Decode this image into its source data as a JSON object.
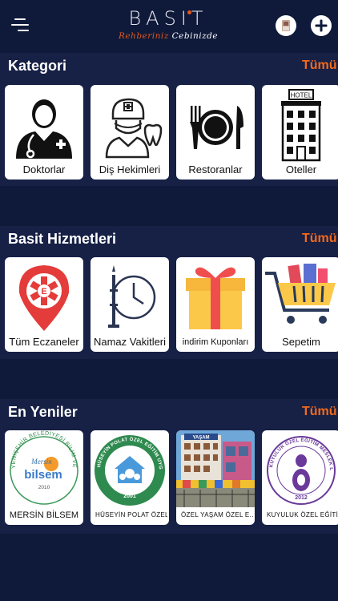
{
  "header": {
    "logo_main": "BASIT",
    "logo_sub_red": "Rehberiniz",
    "logo_sub_white": "Cebinizde",
    "icons": [
      "menu-icon",
      "profile-icon",
      "plus-icon"
    ]
  },
  "sections": [
    {
      "title": "Kategori",
      "all_label": "Tümü",
      "cards": [
        {
          "label": "Doktorlar",
          "icon": "doctor-icon"
        },
        {
          "label": "Diş Hekimleri",
          "icon": "dentist-icon"
        },
        {
          "label": "Restoranlar",
          "icon": "restaurant-icon"
        },
        {
          "label": "Oteller",
          "icon": "hotel-icon"
        }
      ]
    },
    {
      "title": "Basit Hizmetleri",
      "all_label": "Tümü",
      "cards": [
        {
          "label": "Tüm Eczaneler",
          "icon": "pharmacy-icon"
        },
        {
          "label": "Namaz Vakitleri",
          "icon": "prayer-time-icon"
        },
        {
          "label": "indirim Kuponları",
          "icon": "gift-icon"
        },
        {
          "label": "Sepetim",
          "icon": "cart-icon"
        }
      ]
    },
    {
      "title": "En Yeniler",
      "all_label": "Tümü",
      "cards": [
        {
          "label": "MERSİN BİLSEM",
          "logo_text": "Mersin bilsem",
          "logo_year": "2010",
          "ring_text": "YENİŞEHİR BELEDİYESİ BİLİM VE SANAT MERKEZİ"
        },
        {
          "label": "HÜSEYİN POLAT ÖZEL...",
          "logo_year": "2001",
          "ring_text": "HÜSEYİN POLAT ÖZEL EĞİTİM UYGULAMA MERKEZİ"
        },
        {
          "label": "ÖZEL YAŞAM ÖZEL E...",
          "sign_text": "YAŞAM"
        },
        {
          "label": "KUYULUK ÖZEL EĞİTİ...",
          "logo_year": "2012",
          "ring_text": "KUYULUK ÖZEL EĞİTİM MESLEK LİSESİ"
        }
      ]
    }
  ],
  "colors": {
    "background": "#0f1a3a",
    "band": "#172045",
    "accent": "#f36a1b",
    "logo_red": "#e1561c"
  }
}
